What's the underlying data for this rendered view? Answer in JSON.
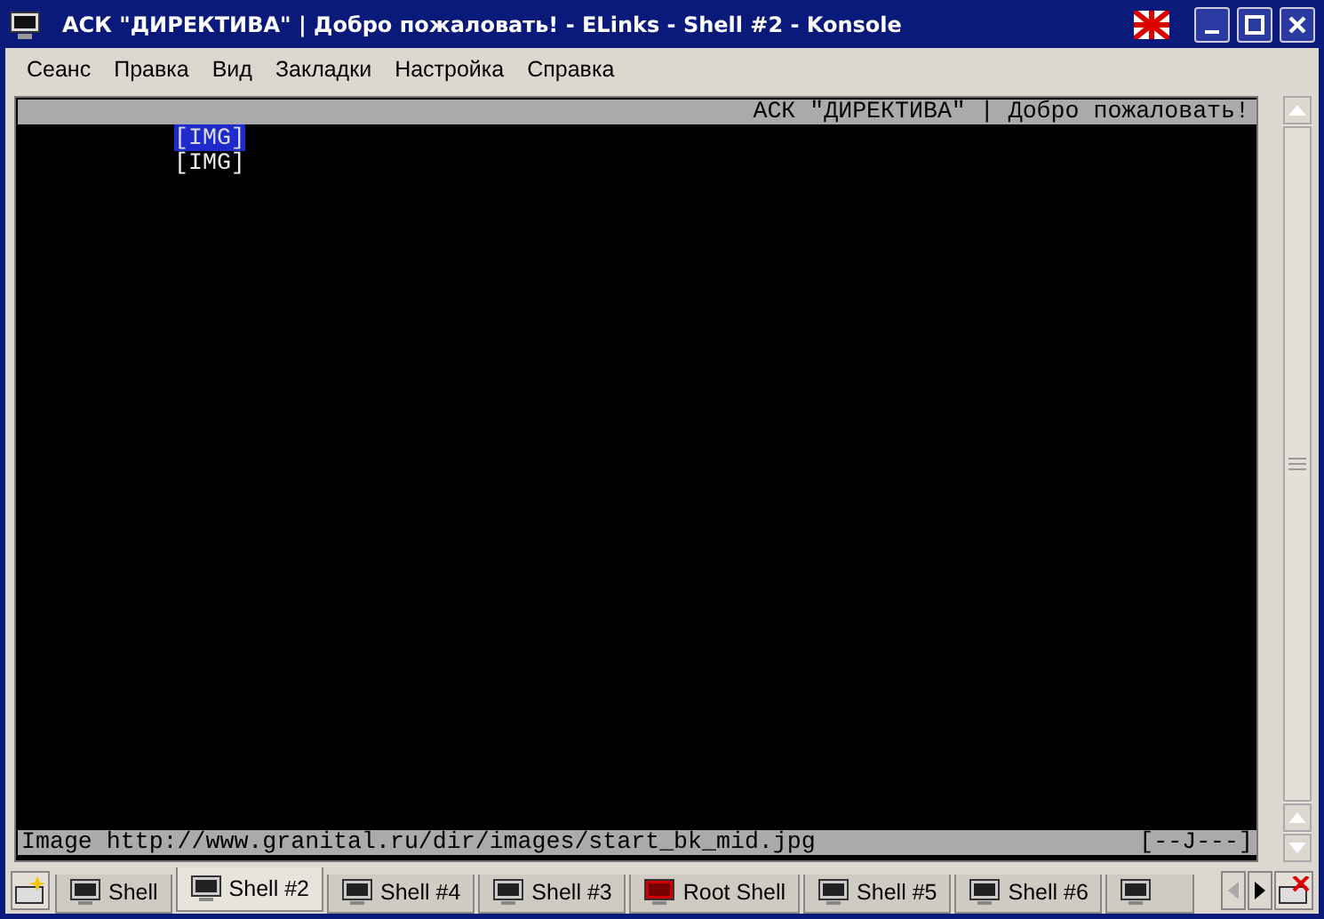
{
  "window": {
    "title": "АСК \"ДИРЕКТИВА\" | Добро пожаловать! - ELinks - Shell #2 - Konsole"
  },
  "menu": [
    "Сеанс",
    "Правка",
    "Вид",
    "Закладки",
    "Настройка",
    "Справка"
  ],
  "terminal": {
    "title_bar": "АСК \"ДИРЕКТИВА\" | Добро пожаловать!",
    "links": [
      {
        "text": "[IMG]",
        "selected": true
      },
      {
        "text": "[IMG]",
        "selected": false
      }
    ],
    "status": "Image http://www.granital.ru/dir/images/start_bk_mid.jpg",
    "status_right": "[--J---]"
  },
  "tabs": [
    {
      "label": "Shell",
      "kind": "shell",
      "selected": false
    },
    {
      "label": "Shell #2",
      "kind": "shell",
      "selected": true
    },
    {
      "label": "Shell #4",
      "kind": "shell",
      "selected": false
    },
    {
      "label": "Shell #3",
      "kind": "shell",
      "selected": false
    },
    {
      "label": "Root Shell",
      "kind": "root",
      "selected": false
    },
    {
      "label": "Shell #5",
      "kind": "shell",
      "selected": false
    },
    {
      "label": "Shell #6",
      "kind": "shell",
      "selected": false
    },
    {
      "kind": "shell",
      "selected": false
    }
  ]
}
